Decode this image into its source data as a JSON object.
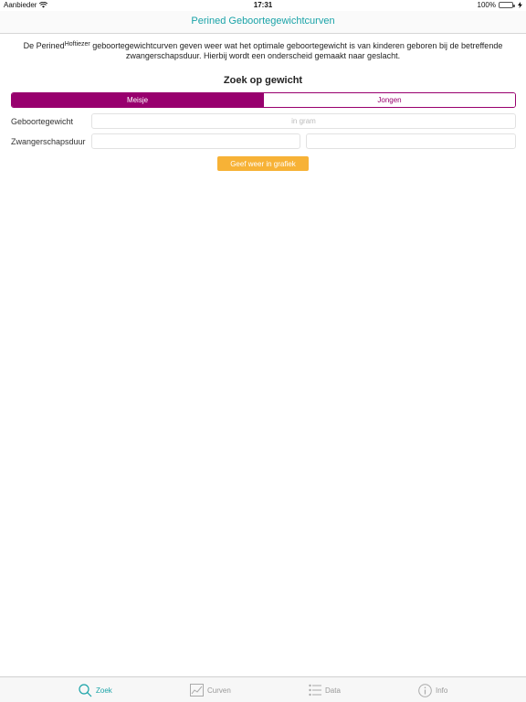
{
  "status_bar": {
    "carrier": "Aanbieder",
    "time": "17:31",
    "battery": "100%"
  },
  "nav": {
    "title": "Perined Geboortegewichtcurven"
  },
  "intro": {
    "prefix": "De Perined",
    "superscript": "Hoftiezer",
    "text": " geboortegewichtcurven geven weer wat het optimale geboortegewicht is van kinderen geboren bij de betreffende zwangerschapsduur. Hierbij wordt een onderscheid gemaakt naar geslacht."
  },
  "search": {
    "title": "Zoek op gewicht",
    "gender_options": [
      "Meisje",
      "Jongen"
    ],
    "selected_gender": "Meisje",
    "weight_label": "Geboortegewicht",
    "weight_placeholder": "in gram",
    "weight_value": "",
    "duration_label": "Zwangerschapsduur",
    "duration_weeks_value": "",
    "duration_days_value": "",
    "submit_label": "Geef weer in grafiek"
  },
  "tabs": [
    {
      "label": "Zoek",
      "icon": "search-icon",
      "selected": true
    },
    {
      "label": "Curven",
      "icon": "chart-icon",
      "selected": false
    },
    {
      "label": "Data",
      "icon": "list-icon",
      "selected": false
    },
    {
      "label": "Info",
      "icon": "info-icon",
      "selected": false
    }
  ],
  "colors": {
    "accent_teal": "#1aa3a8",
    "gender_purple": "#98006e",
    "button_orange": "#f7b236"
  }
}
